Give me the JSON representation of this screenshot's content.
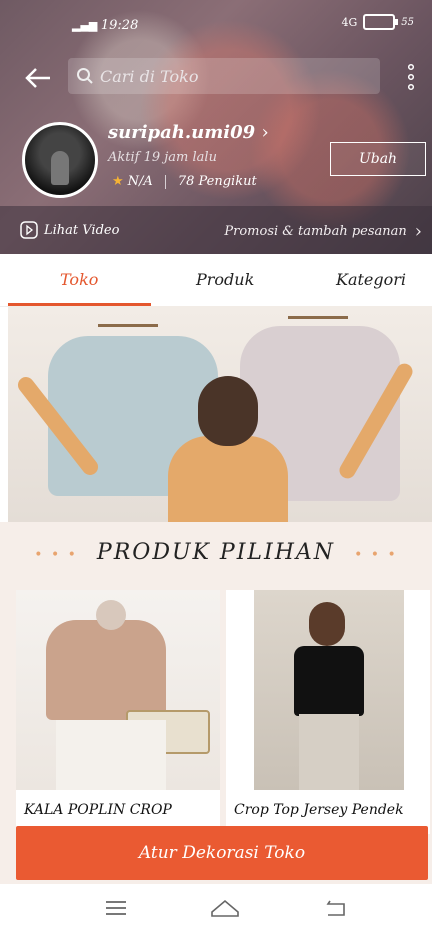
{
  "status_bar": {
    "time": "19:28",
    "signal": "4G",
    "battery": "55"
  },
  "header": {
    "search_placeholder": "Cari di Toko",
    "username": "suripah.umi09",
    "active_text": "Aktif 19 jam lalu",
    "rating": "N/A",
    "followers": "78 Pengikut",
    "edit_label": "Ubah",
    "video_label": "Lihat Video",
    "promo_label": "Promosi & tambah pesanan"
  },
  "tabs": [
    {
      "label": "Toko"
    },
    {
      "label": "Produk"
    },
    {
      "label": "Kategori"
    }
  ],
  "featured": {
    "title": "PRODUK PILIHAN",
    "products": [
      {
        "name": "KALA POPLIN CROP"
      },
      {
        "name": "Crop Top Jersey Pendek"
      }
    ]
  },
  "cta": {
    "label": "Atur Dekorasi Toko"
  },
  "colors": {
    "accent": "#e4572e",
    "cta": "#ea5a32"
  }
}
